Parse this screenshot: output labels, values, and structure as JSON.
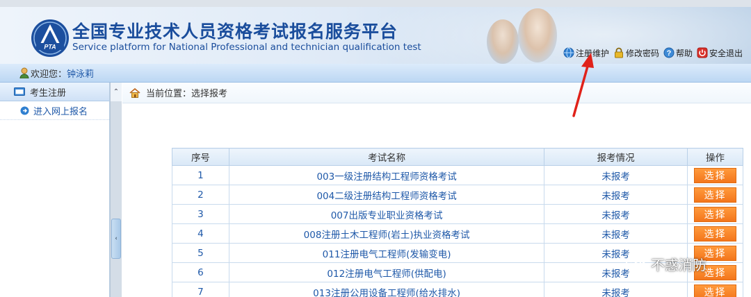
{
  "header": {
    "title_zh": "全国专业技术人员资格考试报名服务平台",
    "title_en": "Service platform for National Professional and technician qualification test",
    "logo_text": "PTA"
  },
  "toplinks": [
    {
      "label": "注册维护",
      "icon": "globe-icon"
    },
    {
      "label": "修改密码",
      "icon": "lock-icon"
    },
    {
      "label": "帮助",
      "icon": "help-icon"
    },
    {
      "label": "安全退出",
      "icon": "power-icon"
    }
  ],
  "welcome": {
    "label": "欢迎您：",
    "name": "钟泳莉"
  },
  "sidebar": {
    "section": "考生注册",
    "items": [
      {
        "label": "进入网上报名"
      }
    ]
  },
  "breadcrumb": {
    "text": "当前位置：选择报考"
  },
  "table": {
    "headers": [
      "序号",
      "考试名称",
      "报考情况",
      "操作"
    ],
    "button_label": "选择",
    "rows": [
      {
        "seq": "1",
        "name": "003一级注册结构工程师资格考试",
        "status": "未报考"
      },
      {
        "seq": "2",
        "name": "004二级注册结构工程师资格考试",
        "status": "未报考"
      },
      {
        "seq": "3",
        "name": "007出版专业职业资格考试",
        "status": "未报考"
      },
      {
        "seq": "4",
        "name": "008注册土木工程师(岩土)执业资格考试",
        "status": "未报考"
      },
      {
        "seq": "5",
        "name": "011注册电气工程师(发输变电)",
        "status": "未报考"
      },
      {
        "seq": "6",
        "name": "012注册电气工程师(供配电)",
        "status": "未报考"
      },
      {
        "seq": "7",
        "name": "013注册公用设备工程师(给水排水)",
        "status": "未报考"
      }
    ]
  },
  "watermark": {
    "text": "不惑消防"
  },
  "colors": {
    "brand_blue": "#1a4d9c",
    "link_blue": "#1e58a8",
    "button_orange": "#f3761c",
    "annotation_red": "#e0221a"
  }
}
